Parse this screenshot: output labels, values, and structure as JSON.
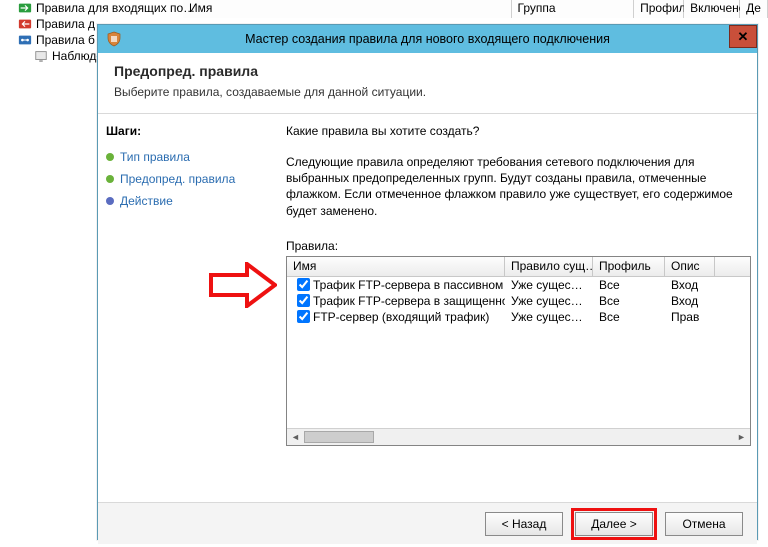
{
  "bg": {
    "cols": {
      "name": "Имя",
      "group": "Группа",
      "profile": "Профиль",
      "enabled": "Включено",
      "action": "Де"
    },
    "tree": {
      "item0": "Правила для входящих по…",
      "item1": "Правила д",
      "item2": "Правила б",
      "item3": "Наблюден"
    }
  },
  "wizard": {
    "title": "Мастер создания правила для нового входящего подключения",
    "header": {
      "title": "Предопред. правила",
      "subtitle": "Выберите правила, создаваемые для данной ситуации."
    },
    "steps_label": "Шаги:",
    "steps": {
      "s0": "Тип правила",
      "s1": "Предопред. правила",
      "s2": "Действие"
    },
    "main": {
      "prompt": "Какие правила вы хотите создать?",
      "desc": "Следующие правила определяют требования сетевого подключения для выбранных предопределенных групп. Будут созданы правила, отмеченные флажком. Если отмеченное флажком правило уже существует, его содержимое будет заменено.",
      "rules_label": "Правила:",
      "cols": {
        "name": "Имя",
        "exists": "Правило сущ…",
        "profile": "Профиль",
        "desc": "Опис"
      },
      "rows": [
        {
          "name": "Трафик FTP-сервера в пассивном режим…",
          "exists": "Уже существ…",
          "profile": "Все",
          "desc": "Вход"
        },
        {
          "name": "Трафик FTP-сервера в защищенном режи…",
          "exists": "Уже существ…",
          "profile": "Все",
          "desc": "Вход"
        },
        {
          "name": "FTP-сервер (входящий трафик)",
          "exists": "Уже существ…",
          "profile": "Все",
          "desc": "Прав"
        }
      ]
    },
    "buttons": {
      "back": "< Назад",
      "next": "Далее >",
      "cancel": "Отмена"
    }
  }
}
